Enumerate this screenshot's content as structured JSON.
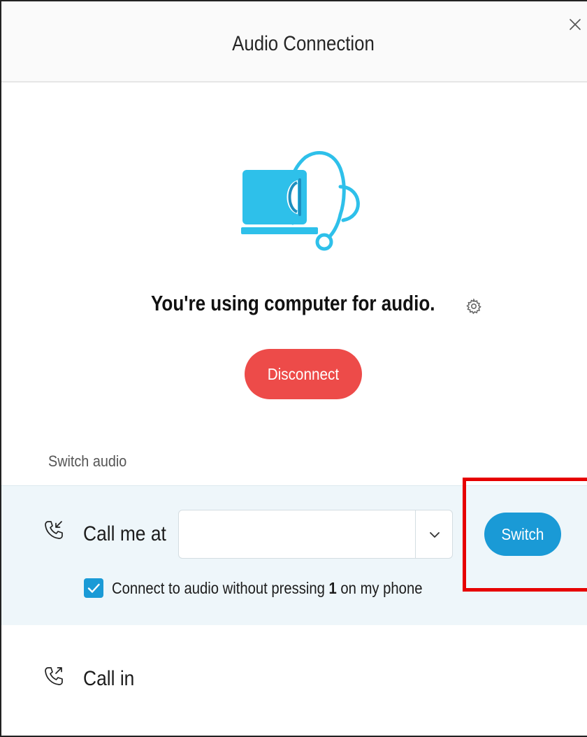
{
  "dialog": {
    "title": "Audio Connection",
    "close_icon": "close-icon"
  },
  "status": {
    "message": "You're using computer for audio.",
    "settings_icon": "gear-icon",
    "hero_icon": "laptop-headset-icon",
    "disconnect_label": "Disconnect"
  },
  "switch_audio": {
    "section_label": "Switch audio",
    "call_me": {
      "icon": "phone-incoming-icon",
      "label": "Call me at",
      "phone_value": "",
      "dropdown_icon": "chevron-down-icon",
      "switch_label": "Switch",
      "checkbox_checked": true,
      "checkbox_text_before": "Connect to audio without pressing ",
      "checkbox_text_key": "1",
      "checkbox_text_after": " on my phone"
    },
    "call_in": {
      "icon": "phone-outgoing-icon",
      "label": "Call in"
    }
  },
  "colors": {
    "accent": "#1a9ad6",
    "danger": "#ed4b49",
    "hero_fill": "#2ec0ea",
    "highlight": "#e60000",
    "selected_row_bg": "#eef6fa"
  }
}
